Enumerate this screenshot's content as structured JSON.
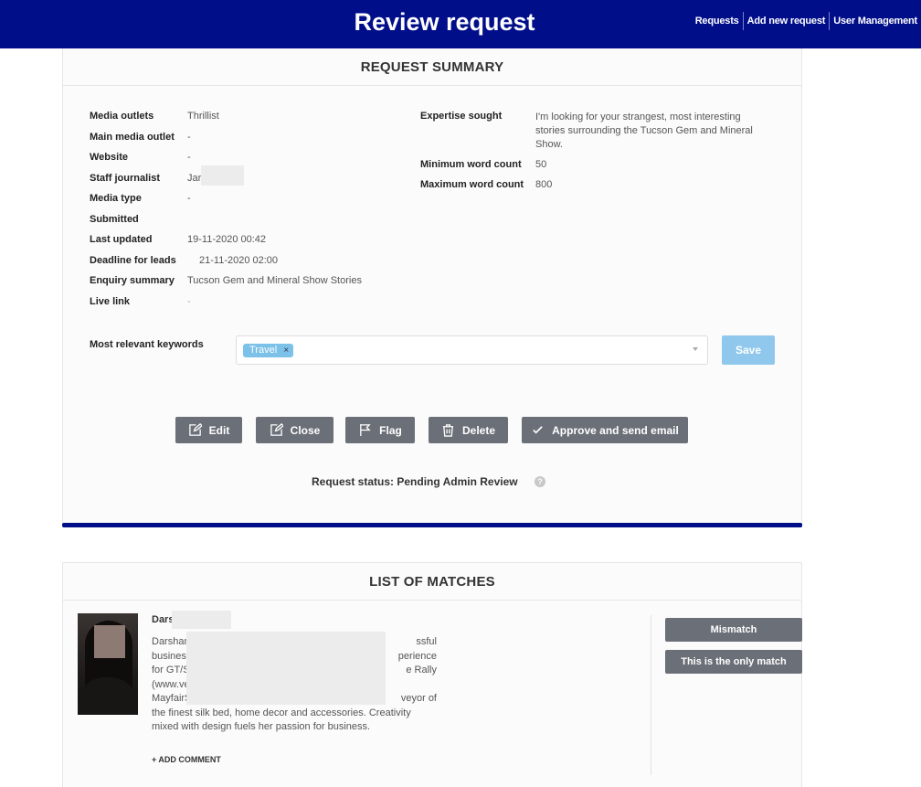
{
  "header": {
    "title": "Review request",
    "nav": [
      "Requests",
      "Add new request",
      "User Management"
    ]
  },
  "summary": {
    "heading": "REQUEST SUMMARY",
    "left_fields": [
      {
        "label": "Media outlets",
        "value": "Thrillist"
      },
      {
        "label": "Main media outlet",
        "value": "-"
      },
      {
        "label": "Website",
        "value": "-"
      },
      {
        "label": "Staff journalist",
        "value": "Jar"
      },
      {
        "label": "Media type",
        "value": "-"
      },
      {
        "label": "Submitted",
        "value": ""
      },
      {
        "label": "Last updated",
        "value": "19-11-2020 00:42"
      },
      {
        "label": "Deadline for leads",
        "value": "21-11-2020 02:00"
      },
      {
        "label": "Enquiry summary",
        "value": "Tucson Gem and Mineral Show Stories"
      },
      {
        "label": "Live link",
        "value": "-"
      }
    ],
    "right_fields": [
      {
        "label": "Expertise sought",
        "value": "I'm looking for your strangest, most interesting stories surrounding the Tucson Gem and Mineral Show."
      },
      {
        "label": "Minimum word count",
        "value": "50"
      },
      {
        "label": "Maximum word count",
        "value": "800"
      }
    ],
    "keywords_label": "Most relevant keywords",
    "keywords": [
      "Travel"
    ],
    "tag_remove": "×",
    "save_label": "Save",
    "actions": {
      "edit": "Edit",
      "close": "Close",
      "flag": "Flag",
      "delete": "Delete",
      "approve": "Approve and send email"
    },
    "status": "Request status: Pending Admin Review",
    "help_glyph": "?"
  },
  "matches": {
    "heading": "LIST OF MATCHES",
    "items": [
      {
        "name": "Dars",
        "bio_lines": [
          "Darshan",
          "business",
          "for GT/S",
          "(www.ve",
          "MayfairS",
          "the finest silk bed, home decor and accessories. Creativity",
          "mixed with design fuels her passion for business."
        ],
        "bio_right": [
          "ssful",
          "perience",
          "e Rally",
          "",
          "veyor of"
        ],
        "add_comment": "+ ADD COMMENT",
        "mismatch_label": "Mismatch",
        "only_match_label": "This is the only match"
      }
    ]
  }
}
